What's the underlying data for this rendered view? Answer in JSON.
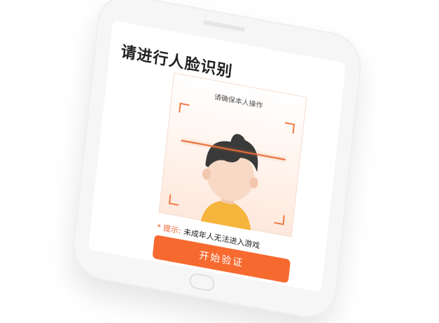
{
  "page": {
    "title": "请进行人脸识别",
    "face_hint": "请确保本人操作",
    "tip_label": "* 提示:",
    "tip_text": "未成年人无法进入游戏",
    "start_button": "开始验证"
  },
  "icons": {
    "avatar": "cartoon-face-icon",
    "corners": "scan-frame-corner-icon"
  },
  "colors": {
    "accent": "#f66a2f",
    "scan_line": "#e8703a",
    "tip": "#f0612a",
    "hair": "#3a3a3a",
    "shirt": "#f5b43c",
    "skin": "#f8d9c6"
  }
}
